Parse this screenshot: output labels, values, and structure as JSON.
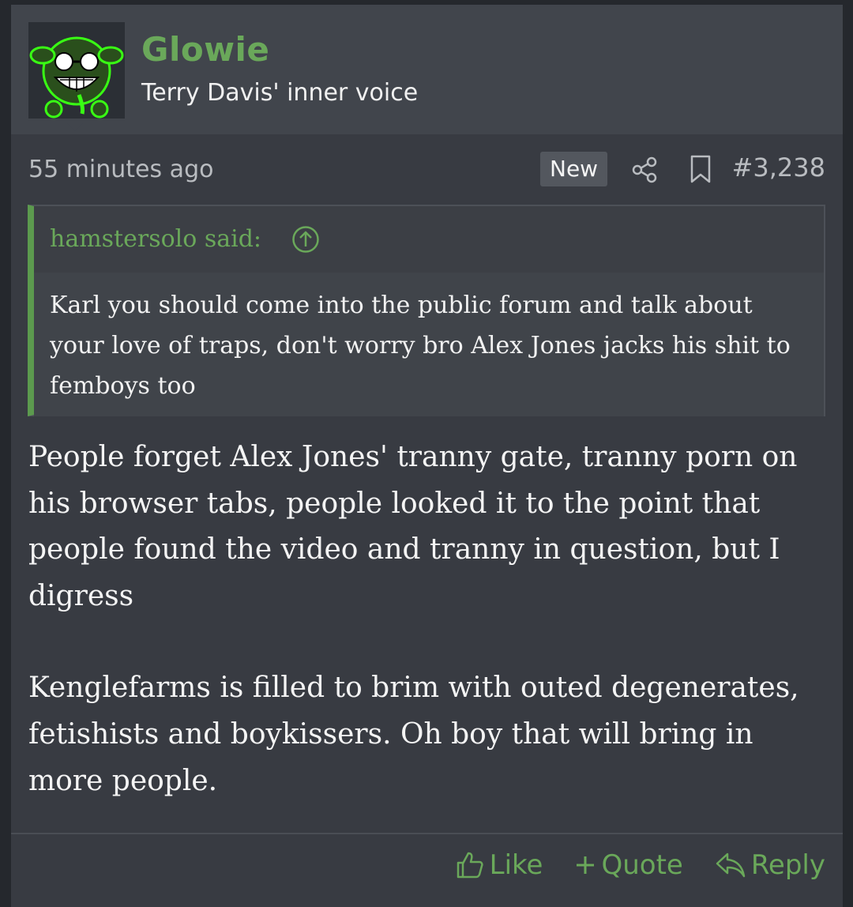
{
  "user": {
    "name": "Glowie",
    "title": "Terry Davis' inner voice"
  },
  "meta": {
    "time": "55 minutes ago",
    "badge": "New",
    "post_number": "#3,238"
  },
  "quote": {
    "author_label": "hamstersolo said:",
    "body": "Karl you should come into the public forum and talk about your love of traps, don't worry bro Alex Jones jacks his shit to femboys too"
  },
  "message": {
    "paragraphs": [
      "People forget Alex Jones' tranny gate, tranny porn on his browser tabs, people looked it to the point that people found the video and tranny in question, but I digress",
      "Kenglefarms is filled to brim with outed degenerates, fetishists and boykissers. Oh boy that will bring in more people."
    ]
  },
  "actions": {
    "like": "Like",
    "quote": "Quote",
    "reply": "Reply"
  },
  "colors": {
    "accent_green": "#6aa85a",
    "background": "#383b42",
    "header_background": "#41454c"
  },
  "icons": [
    "share-icon",
    "bookmark-icon",
    "arrow-up-circle-icon",
    "thumbs-up-icon",
    "plus-icon",
    "reply-icon"
  ]
}
